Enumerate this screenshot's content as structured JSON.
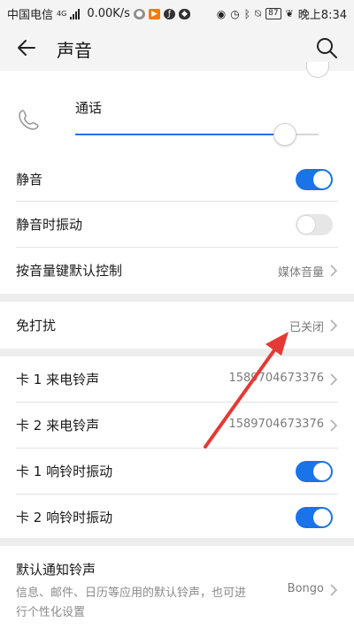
{
  "status_bar": {
    "carrier": "中国电信",
    "network_type": "4G",
    "speed": "0.00K/s",
    "battery": "87",
    "time": "晚上8:34"
  },
  "header": {
    "title": "声音",
    "back_icon": "arrow-left-icon",
    "search_icon": "search-icon"
  },
  "volume": {
    "call_label": "通话",
    "call_icon": "phone-icon",
    "call_level": 0.86
  },
  "rows": {
    "mute": {
      "label": "静音",
      "on": true
    },
    "mute_vibrate": {
      "label": "静音时振动",
      "on": false
    },
    "volume_key": {
      "label": "按音量键默认控制",
      "value": "媒体音量"
    },
    "dnd": {
      "label": "免打扰",
      "value": "已关闭"
    },
    "sim1_ringtone": {
      "label": "卡 1 来电铃声",
      "value": "15897046733​76"
    },
    "sim2_ringtone": {
      "label": "卡 2 来电铃声",
      "value": "15897046733​76"
    },
    "sim1_vibrate": {
      "label": "卡 1 响铃时振动",
      "on": true
    },
    "sim2_vibrate": {
      "label": "卡 2 响铃时振动",
      "on": true
    },
    "notification": {
      "label": "默认通知铃声",
      "description": "信息、邮件、日历等应用的默认铃声，也可进行个性化设置",
      "value": "Bongo"
    }
  },
  "colors": {
    "accent": "#1a73e8",
    "annotation_arrow": "#e53935"
  }
}
